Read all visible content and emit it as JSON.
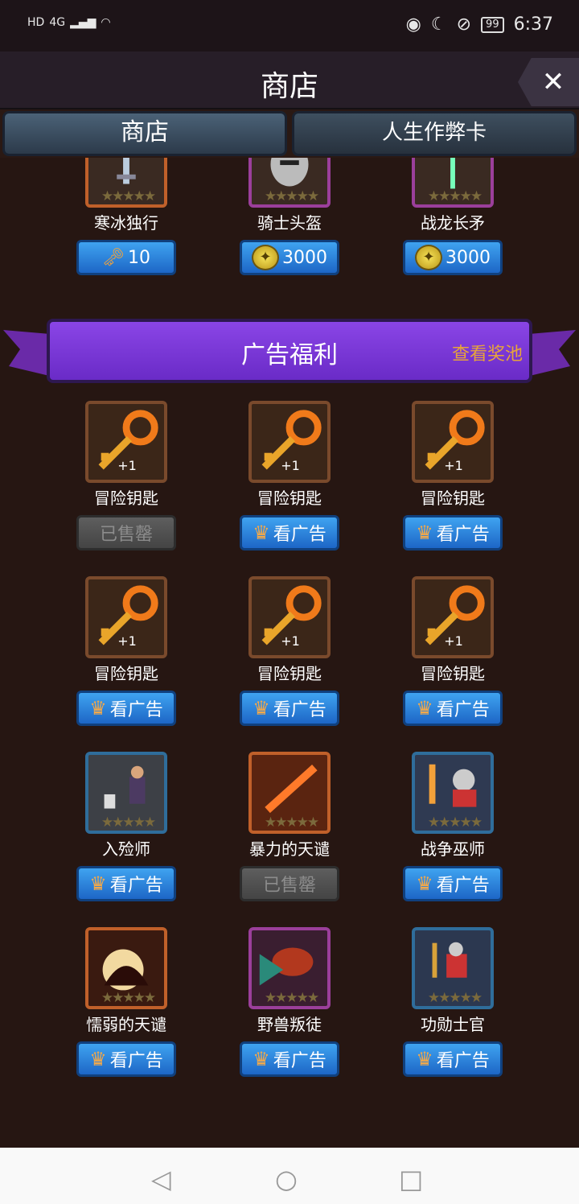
{
  "status_bar": {
    "left": [
      "HD",
      "4G"
    ],
    "battery": "99",
    "time": "6:37"
  },
  "header": {
    "title": "商店",
    "close_icon": "close-icon"
  },
  "tabs": [
    {
      "label": "商店"
    },
    {
      "label": "人生作弊卡"
    }
  ],
  "top_items": [
    {
      "name": "寒冰独行",
      "price": "10",
      "currency": "key-icon"
    },
    {
      "name": "骑士头盔",
      "price": "3000",
      "currency": "coin-icon"
    },
    {
      "name": "战龙长矛",
      "price": "3000",
      "currency": "coin-icon"
    }
  ],
  "banner": {
    "title": "广告福利",
    "link": "查看奖池"
  },
  "ad_items": [
    {
      "name": "冒险钥匙",
      "plus": "+1",
      "button": "已售罄",
      "sold": true
    },
    {
      "name": "冒险钥匙",
      "plus": "+1",
      "button": "看广告",
      "sold": false
    },
    {
      "name": "冒险钥匙",
      "plus": "+1",
      "button": "看广告",
      "sold": false
    },
    {
      "name": "冒险钥匙",
      "plus": "+1",
      "button": "看广告",
      "sold": false
    },
    {
      "name": "冒险钥匙",
      "plus": "+1",
      "button": "看广告",
      "sold": false
    },
    {
      "name": "冒险钥匙",
      "plus": "+1",
      "button": "看广告",
      "sold": false
    },
    {
      "name": "入殓师",
      "button": "看广告",
      "sold": false
    },
    {
      "name": "暴力的天谴",
      "button": "已售罄",
      "sold": true
    },
    {
      "name": "战争巫师",
      "button": "看广告",
      "sold": false
    },
    {
      "name": "懦弱的天谴",
      "button": "看广告",
      "sold": false
    },
    {
      "name": "野兽叛徒",
      "button": "看广告",
      "sold": false
    },
    {
      "name": "功勋士官",
      "button": "看广告",
      "sold": false
    }
  ],
  "stars": "★★★★★",
  "nav": [
    "back-icon",
    "home-icon",
    "recents-icon"
  ]
}
